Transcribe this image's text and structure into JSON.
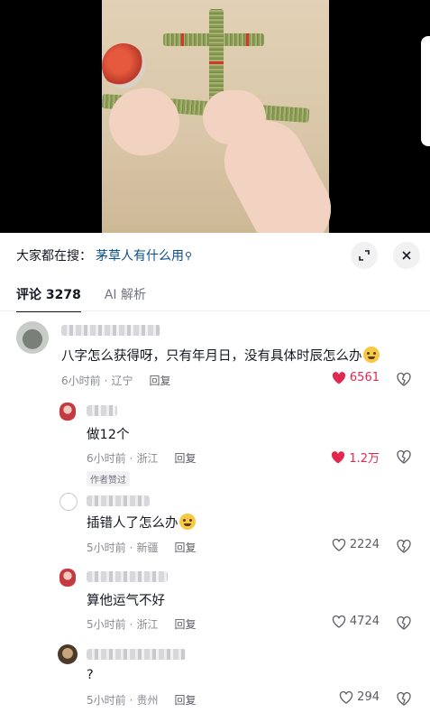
{
  "search": {
    "prefix": "大家都在搜：",
    "query": "茅草人有什么用",
    "query_icon": "search-icon"
  },
  "tabs": {
    "comments_label": "评论 3278",
    "ai_label": "AI 解析"
  },
  "colors": {
    "like_active": "#e1294f",
    "link": "#0b4f8a",
    "meta": "#8a8b91"
  },
  "comments": [
    {
      "text": "八字怎么获得呀，只有年月日，没有具体时辰怎么办",
      "time": "6小时前",
      "location": "辽宁",
      "reply_label": "回复",
      "likes": "6561",
      "liked": true
    },
    {
      "text": "做12个",
      "time": "6小时前",
      "location": "浙江",
      "reply_label": "回复",
      "likes": "1.2万",
      "liked": true,
      "badge": "作者赞过"
    },
    {
      "text": "插错人了怎么办",
      "time": "5小时前",
      "location": "新疆",
      "reply_label": "回复",
      "likes": "2224",
      "liked": false
    },
    {
      "text": "算他运气不好",
      "time": "5小时前",
      "location": "浙江",
      "reply_label": "回复",
      "likes": "4724",
      "liked": false
    },
    {
      "text": "?",
      "time": "5小时前",
      "location": "贵州",
      "reply_label": "回复",
      "likes": "294",
      "liked": false
    }
  ]
}
